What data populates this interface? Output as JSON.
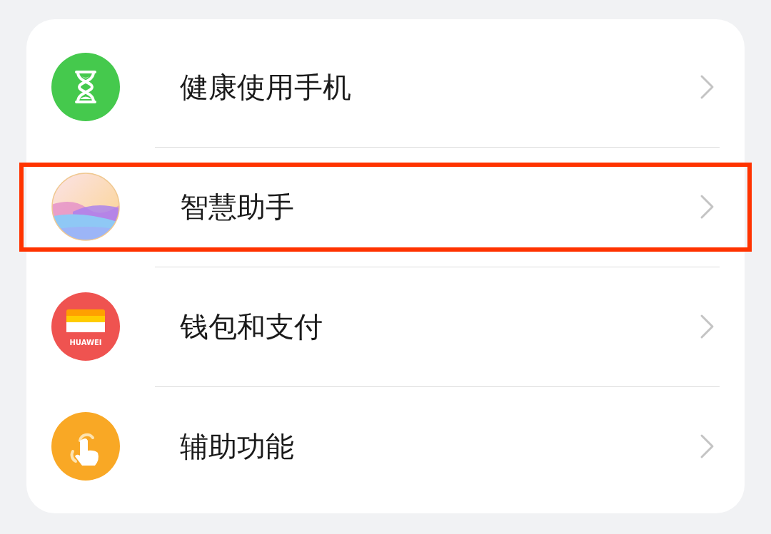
{
  "settings_items": [
    {
      "label": "健康使用手机",
      "kind": "hourglass",
      "highlighted": false
    },
    {
      "label": "智慧助手",
      "kind": "orb",
      "highlighted": true
    },
    {
      "label": "钱包和支付",
      "kind": "wallet",
      "icon_label": "HUAWEI",
      "highlighted": false
    },
    {
      "label": "辅助功能",
      "kind": "touch",
      "highlighted": false
    }
  ]
}
